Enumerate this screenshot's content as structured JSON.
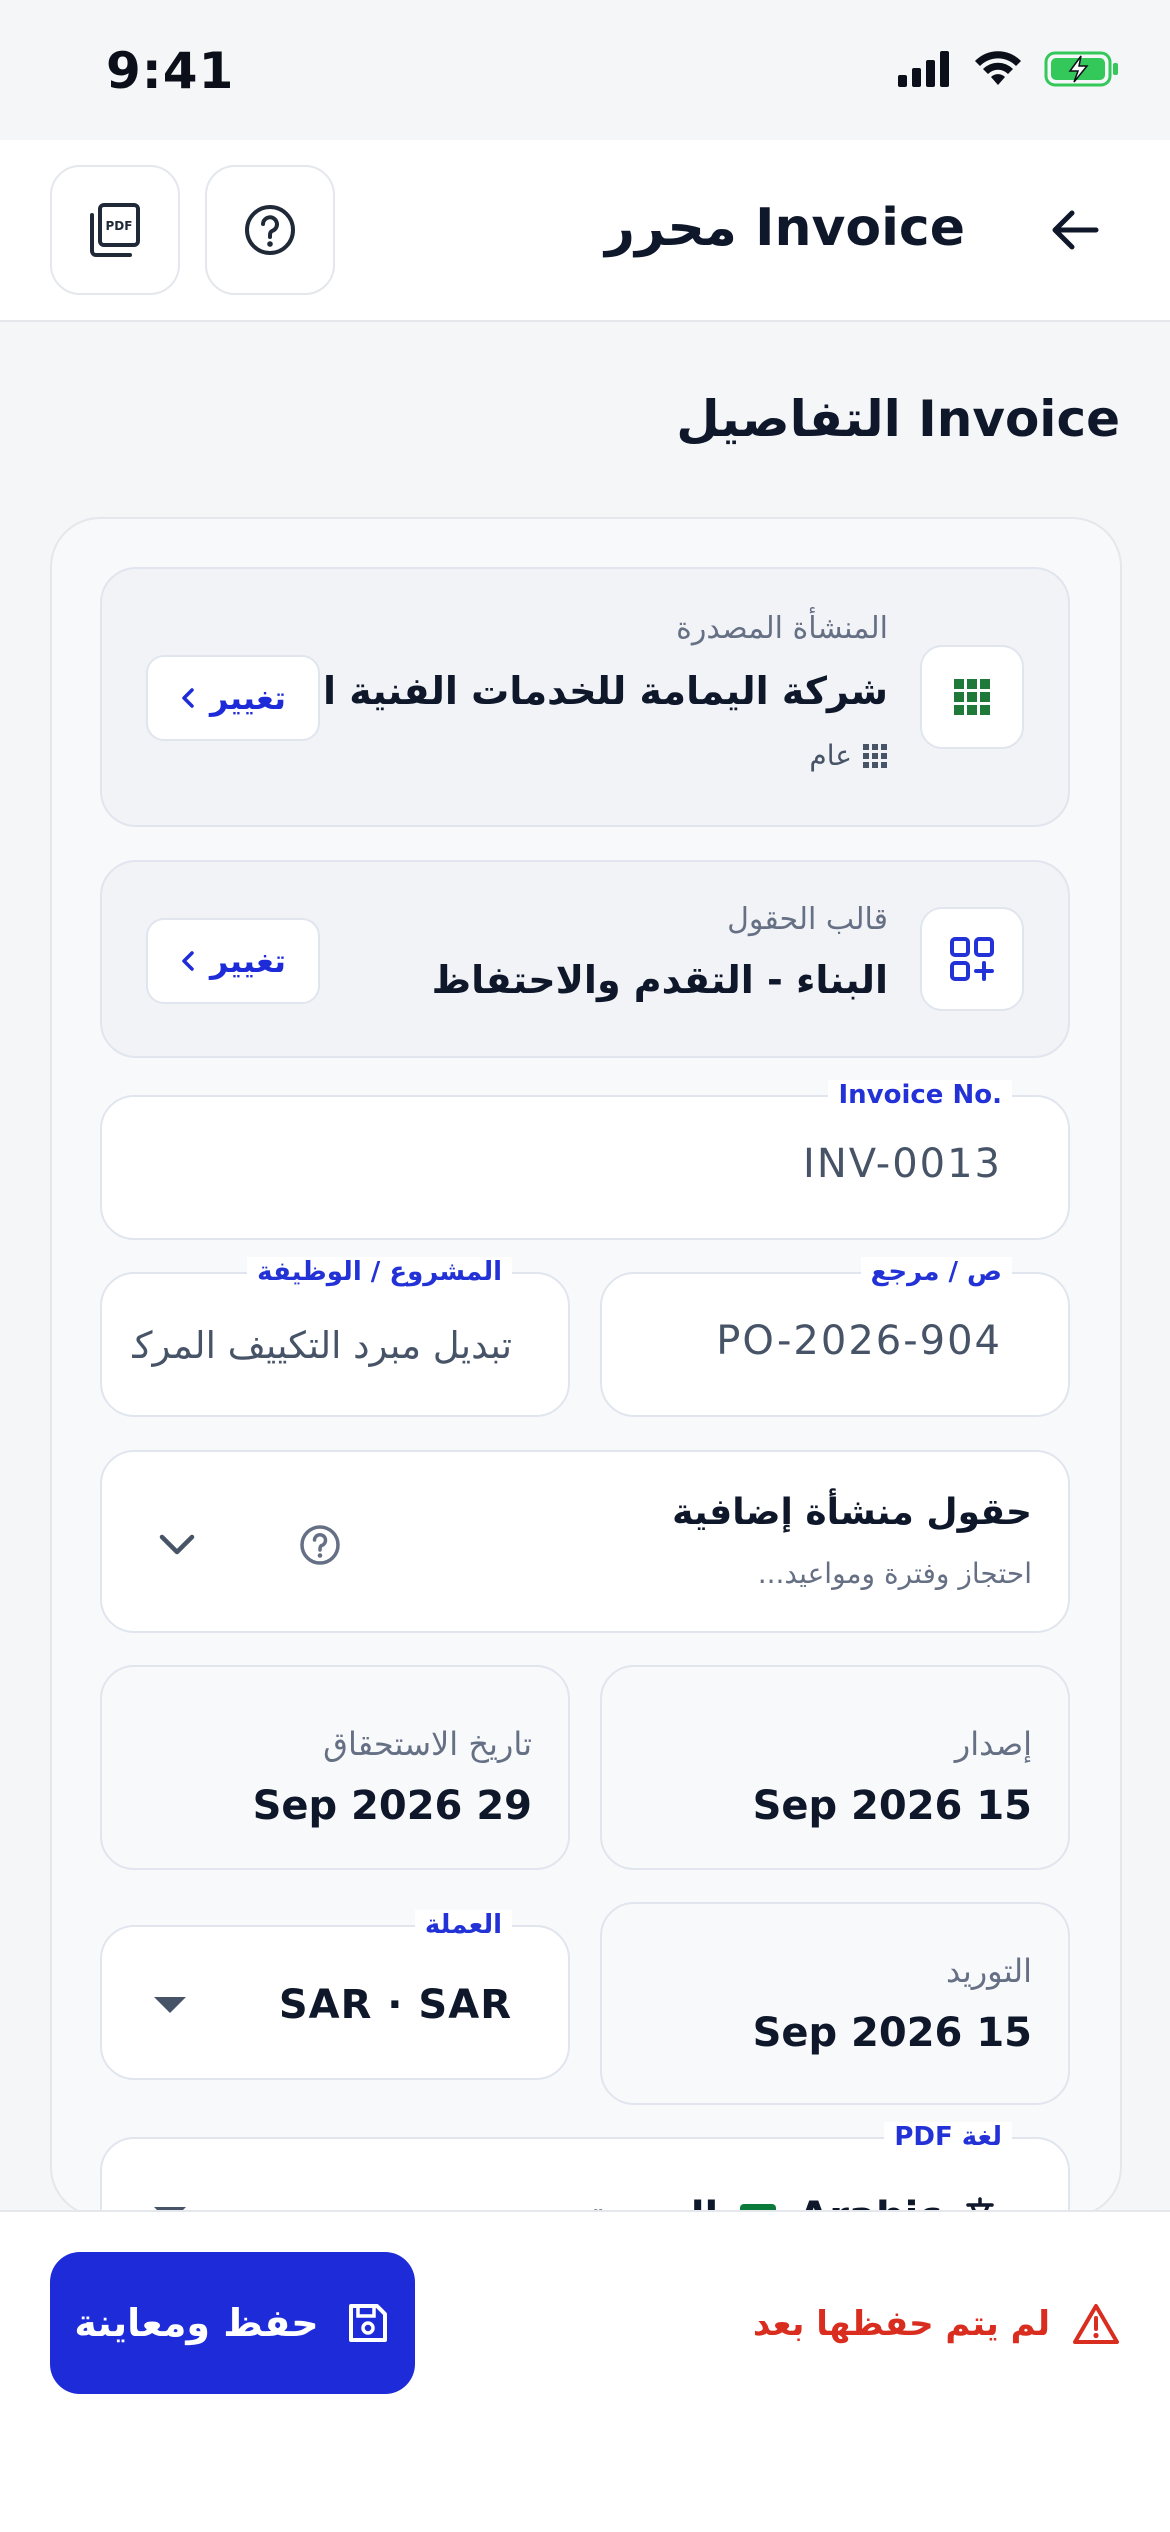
{
  "status_bar": {
    "time": "9:41"
  },
  "header": {
    "title": "Invoice محرر",
    "back_icon": "arrow-left-icon",
    "pdf_icon": "pdf-icon",
    "help_icon": "help-circle-icon"
  },
  "section": {
    "title": "Invoice التفاصيل"
  },
  "issuer": {
    "label": "المنشأة المصدرة",
    "value": "شركة اليمامة للخدمات الفنية الم...",
    "sub": "عام",
    "change_label": "تغيير"
  },
  "template": {
    "label": "قالب الحقول",
    "value": "البناء - التقدم والاحتفاظ",
    "change_label": "تغيير"
  },
  "fields": {
    "invoice_no": {
      "label": "Invoice No.",
      "value": "INV-0013"
    },
    "reference": {
      "label": "ص / مرجع",
      "value": "PO-2026-904"
    },
    "project": {
      "label": "المشروع / الوظيفة",
      "value": "تبديل مبرد التكييف المركزي"
    }
  },
  "extras": {
    "title": "حقول منشأة إضافية",
    "subtitle": "احتجاز وفترة ومواعيد..."
  },
  "dates": {
    "issue": {
      "label": "إصدار",
      "value": "15 Sep 2026"
    },
    "due": {
      "label": "تاريخ الاستحقاق",
      "value": "29 Sep 2026"
    },
    "supply": {
      "label": "التوريد",
      "value": "15 Sep 2026"
    }
  },
  "currency": {
    "label": "العملة",
    "value": "SAR · SAR"
  },
  "pdf_language": {
    "label": "لغة PDF",
    "value_en": "Arabic",
    "value_ar": "العربية"
  },
  "footer": {
    "save_label": "حفظ ومعاينة",
    "unsaved_text": "لم يتم حفظها بعد"
  },
  "colors": {
    "accent": "#1E2BD8",
    "error": "#D92D20",
    "battery": "#34C759",
    "grid_green": "#1F7A3A"
  }
}
